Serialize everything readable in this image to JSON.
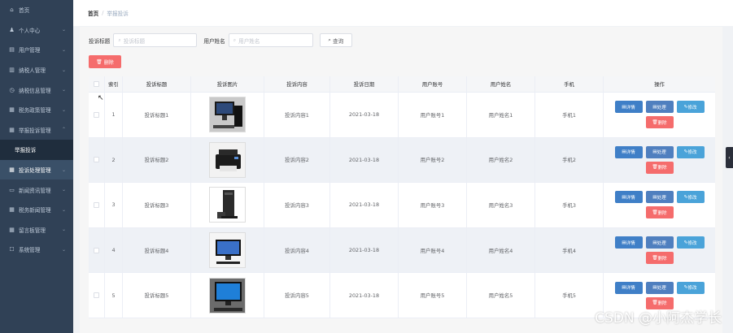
{
  "sidebar": {
    "items": [
      {
        "icon": "home-icon",
        "glyph": "⌂",
        "label": "首页"
      },
      {
        "icon": "user-icon",
        "glyph": "♟",
        "label": "个人中心"
      },
      {
        "icon": "users-icon",
        "glyph": "▤",
        "label": "用户管理"
      },
      {
        "icon": "person-icon",
        "glyph": "▥",
        "label": "纳税人管理"
      },
      {
        "icon": "clock-icon",
        "glyph": "◷",
        "label": "纳税信息管理"
      },
      {
        "icon": "menu-icon",
        "glyph": "▦",
        "label": "税务政策管理"
      },
      {
        "icon": "menu-icon",
        "glyph": "▦",
        "label": "举报投诉管理"
      },
      {
        "label": "举报投诉"
      },
      {
        "icon": "grid-icon",
        "glyph": "▦",
        "label": "投诉处理管理"
      },
      {
        "icon": "chat-icon",
        "glyph": "▭",
        "label": "新闻资讯管理"
      },
      {
        "icon": "grid-icon",
        "glyph": "▦",
        "label": "税务新闻管理"
      },
      {
        "icon": "grid-icon",
        "glyph": "▦",
        "label": "留言板管理"
      },
      {
        "icon": "gear-icon",
        "glyph": "☐",
        "label": "系统管理"
      }
    ]
  },
  "breadcrumb": {
    "home": "首页",
    "separator": "/",
    "current": "举报投诉"
  },
  "search": {
    "title_label": "投诉标题",
    "title_placeholder": "投诉标题",
    "name_label": "用户姓名",
    "name_placeholder": "用户姓名",
    "query_button": "查询"
  },
  "delete_button": "删除",
  "table": {
    "headers": [
      "",
      "索引",
      "投诉标题",
      "投诉图片",
      "投诉内容",
      "投诉日期",
      "用户账号",
      "用户姓名",
      "手机",
      "操作"
    ],
    "rows": [
      {
        "index": "1",
        "title": "投诉标题1",
        "content": "投诉内容1",
        "date": "2021-03-18",
        "account": "用户账号1",
        "name": "用户姓名1",
        "phone": "手机1"
      },
      {
        "index": "2",
        "title": "投诉标题2",
        "content": "投诉内容2",
        "date": "2021-03-18",
        "account": "用户账号2",
        "name": "用户姓名2",
        "phone": "手机2"
      },
      {
        "index": "3",
        "title": "投诉标题3",
        "content": "投诉内容3",
        "date": "2021-03-18",
        "account": "用户账号3",
        "name": "用户姓名3",
        "phone": "手机3"
      },
      {
        "index": "4",
        "title": "投诉标题4",
        "content": "投诉内容4",
        "date": "2021-03-18",
        "account": "用户账号4",
        "name": "用户姓名4",
        "phone": "手机4"
      },
      {
        "index": "5",
        "title": "投诉标题5",
        "content": "投诉内容5",
        "date": "2021-03-18",
        "account": "用户账号5",
        "name": "用户姓名5",
        "phone": "手机5"
      }
    ],
    "actions": {
      "detail": "详情",
      "handle": "处理",
      "edit": "修改",
      "delete": "删除"
    }
  },
  "watermark": "CSDN @小阿杰学长"
}
